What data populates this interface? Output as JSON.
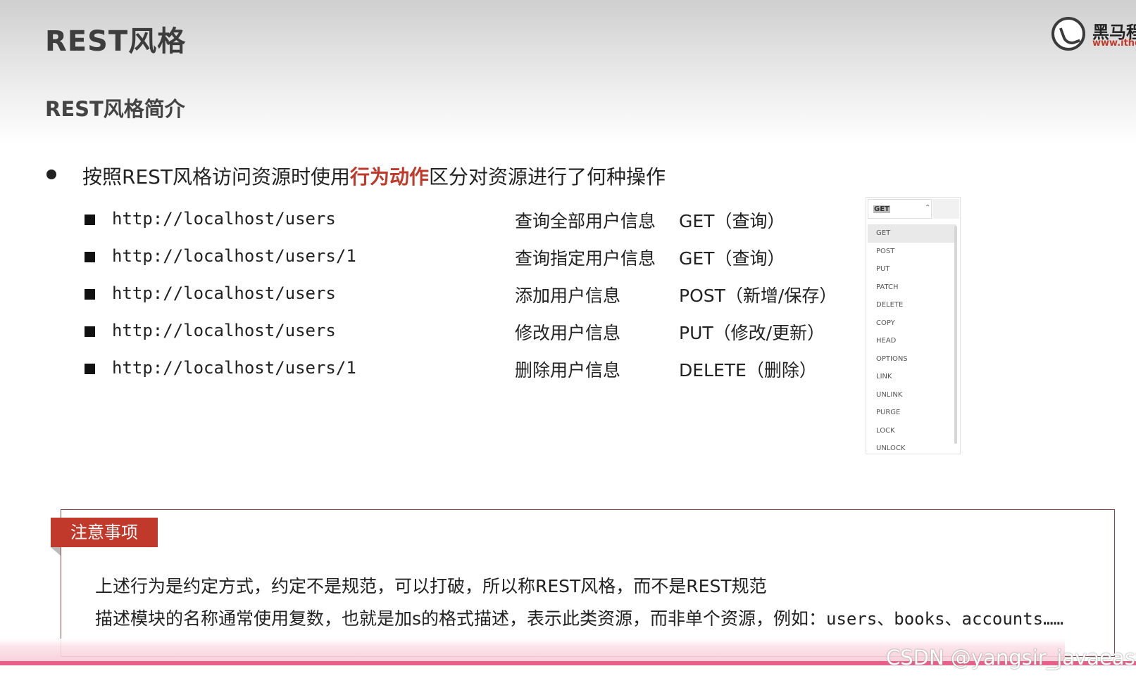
{
  "header": {
    "title": "REST风格",
    "subtitle": "REST风格简介",
    "logo": {
      "name": "黑马程",
      "url": "www.ithei"
    }
  },
  "intro": {
    "before": "按照REST风格访问资源时使用",
    "highlight": "行为动作",
    "after": "区分对资源进行了何种操作"
  },
  "rows": [
    {
      "url": "http://localhost/users",
      "desc": "查询全部用户信息",
      "method": "GET（查询）"
    },
    {
      "url": "http://localhost/users/1",
      "desc": "查询指定用户信息",
      "method": "GET（查询）"
    },
    {
      "url": "http://localhost/users",
      "desc": "添加用户信息",
      "method": "POST（新增/保存）"
    },
    {
      "url": "http://localhost/users",
      "desc": "修改用户信息",
      "method": "PUT（修改/更新）"
    },
    {
      "url": "http://localhost/users/1",
      "desc": "删除用户信息",
      "method": "DELETE（删除）"
    }
  ],
  "dropdown": {
    "selected": "GET",
    "options": [
      "GET",
      "POST",
      "PUT",
      "PATCH",
      "DELETE",
      "COPY",
      "HEAD",
      "OPTIONS",
      "LINK",
      "UNLINK",
      "PURGE",
      "LOCK",
      "UNLOCK"
    ]
  },
  "note": {
    "label": "注意事项",
    "line1": "上述行为是约定方式，约定不是规范，可以打破，所以称REST风格，而不是REST规范",
    "line2_prefix": "描述模块的名称通常使用复数，也就是加s的格式描述，表示此类资源，而非单个资源，例如：",
    "line2_examples": "users、books、accounts……"
  },
  "watermark": "CSDN @yangsir_javaeasy",
  "colors": {
    "accent": "#c0392b",
    "pink_line": "#e8608a"
  }
}
